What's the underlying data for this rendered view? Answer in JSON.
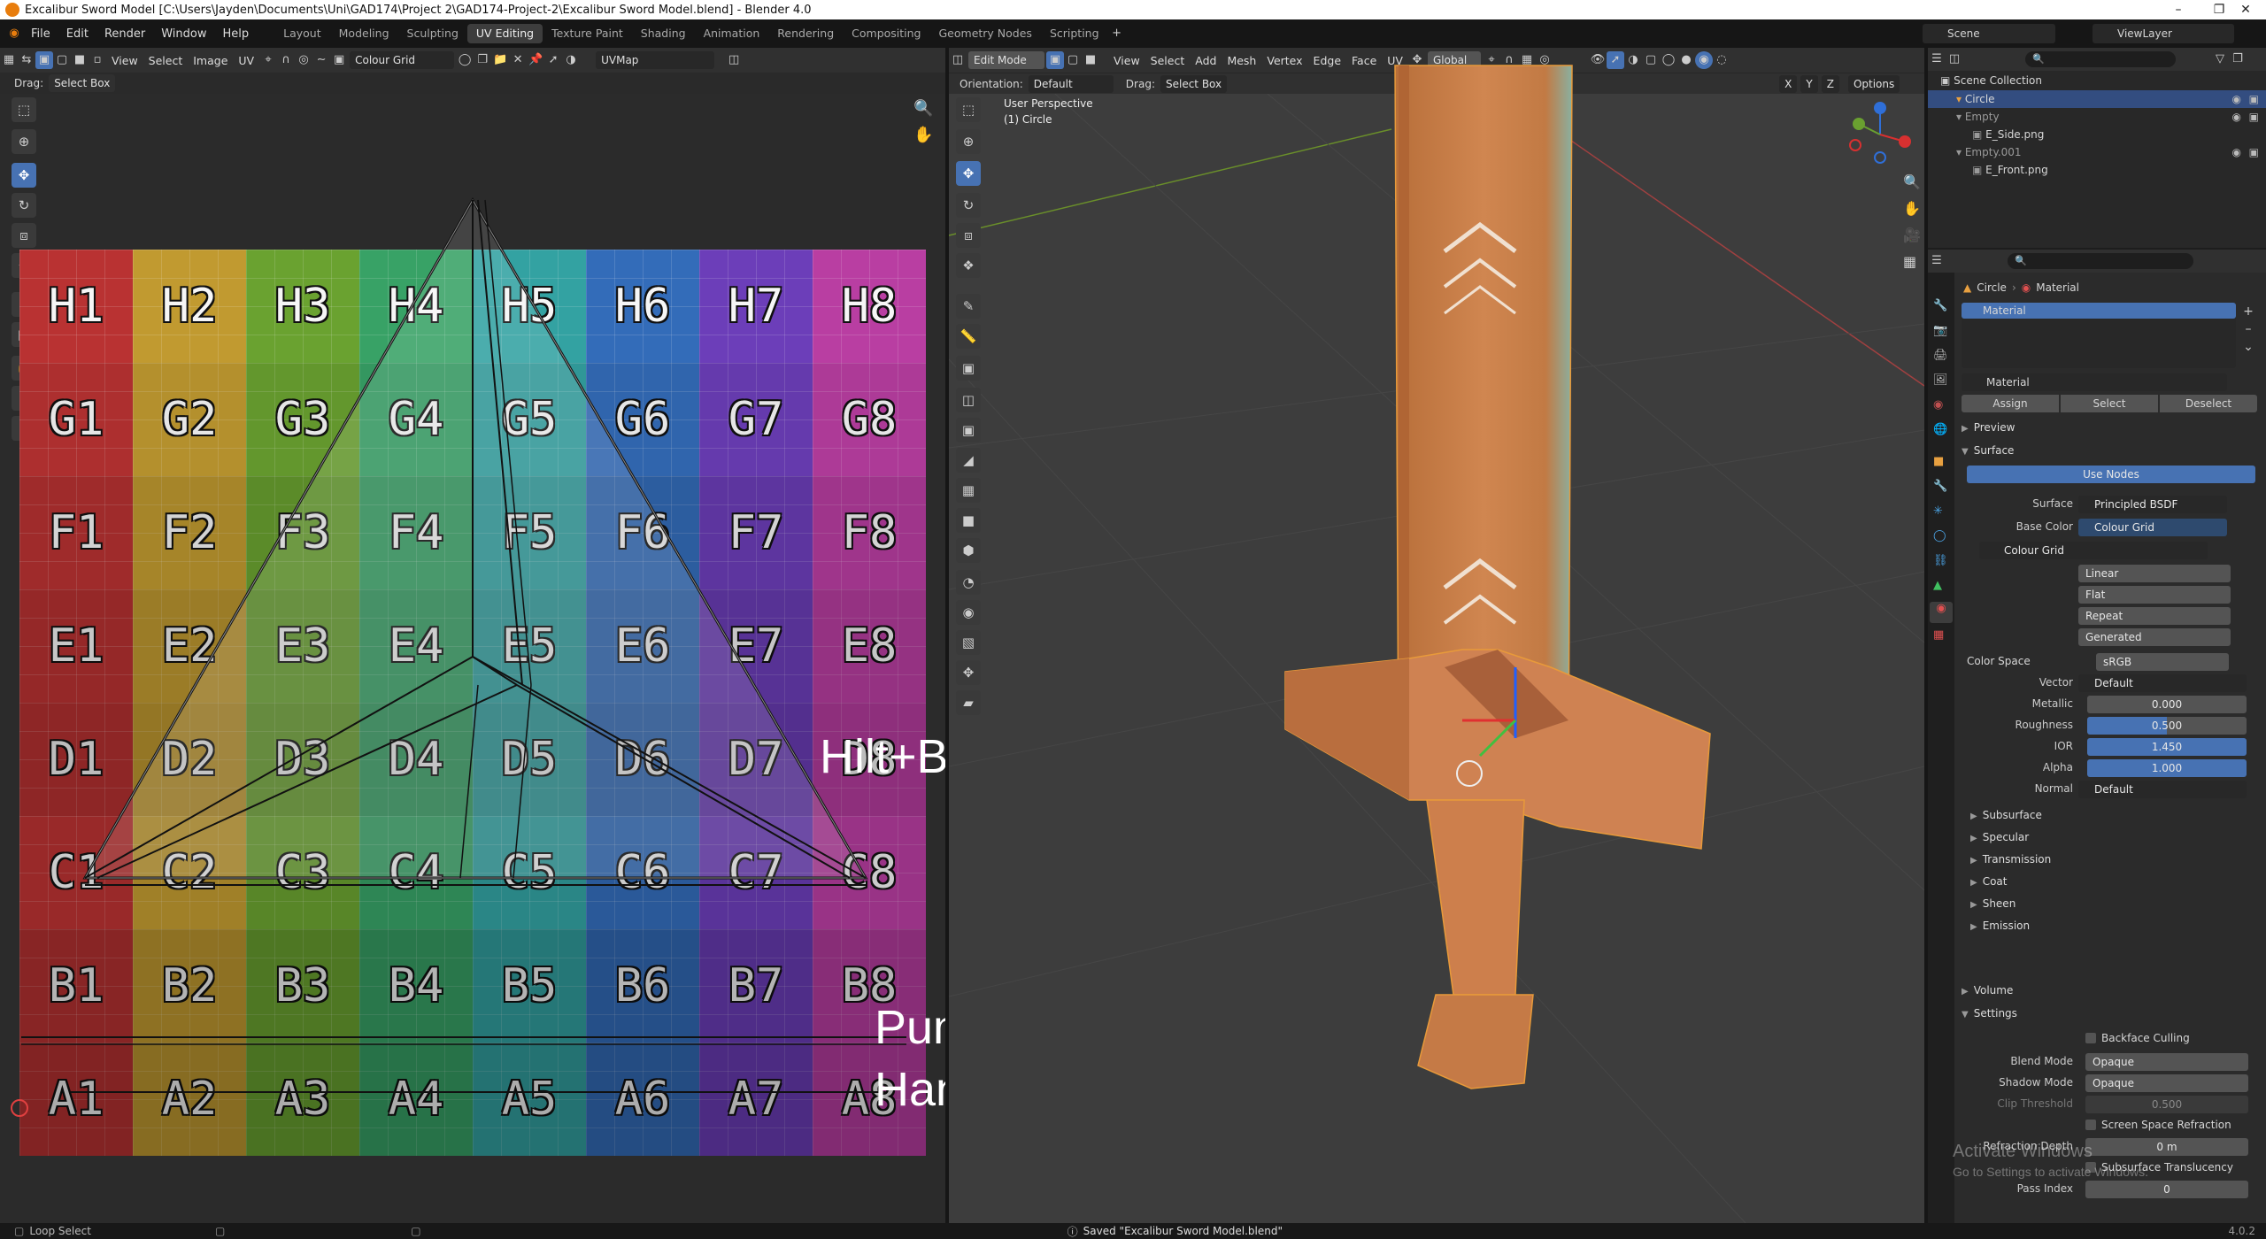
{
  "titlebar": {
    "title": "Excalibur Sword Model [C:\\Users\\Jayden\\Documents\\Uni\\GAD174\\Project 2\\GAD174-Project-2\\Excalibur Sword Model.blend] - Blender 4.0"
  },
  "topbar": {
    "menus": [
      "File",
      "Edit",
      "Render",
      "Window",
      "Help"
    ],
    "workspaces": [
      "Layout",
      "Modeling",
      "Sculpting",
      "UV Editing",
      "Texture Paint",
      "Shading",
      "Animation",
      "Rendering",
      "Compositing",
      "Geometry Nodes",
      "Scripting"
    ],
    "active_workspace": "UV Editing",
    "scene": "Scene",
    "view_layer": "ViewLayer"
  },
  "uv_editor": {
    "menus": [
      "View",
      "Select",
      "Image",
      "UV"
    ],
    "image_name": "Colour Grid",
    "uvmap": "UVMap",
    "drag_label": "Drag:",
    "drag_value": "Select Box",
    "rows": [
      "H",
      "G",
      "F",
      "E",
      "D",
      "C",
      "B",
      "A"
    ],
    "cols": [
      "1",
      "2",
      "3",
      "4",
      "5",
      "6",
      "7",
      "8"
    ],
    "row_colors": [
      "#c03434",
      "#c8a032",
      "#6ea832",
      "#3aa86a",
      "#35a8a8",
      "#3570c0",
      "#7040c0",
      "#c040a8"
    ],
    "annotations": {
      "hilt_blade": "Hilt+Blade",
      "pummel": "Pummle",
      "handle": "Handle"
    }
  },
  "viewport": {
    "mode": "Edit Mode",
    "menus": [
      "View",
      "Select",
      "Add",
      "Mesh",
      "Vertex",
      "Edge",
      "Face",
      "UV"
    ],
    "transform": "Global",
    "orientation_label": "Orientation:",
    "orientation": "Default",
    "drag_label": "Drag:",
    "drag_value": "Select Box",
    "options": "Options",
    "overlay_line1": "User Perspective",
    "overlay_line2": "(1) Circle",
    "axes": {
      "x": "X",
      "y": "Y",
      "z": "Z"
    }
  },
  "outliner": {
    "title": "Scene Collection",
    "items": [
      {
        "name": "Circle",
        "depth": 1,
        "selected": true
      },
      {
        "name": "Empty",
        "depth": 1,
        "selected": false
      },
      {
        "name": "E_Side.png",
        "depth": 2,
        "selected": false
      },
      {
        "name": "Empty.001",
        "depth": 1,
        "selected": false
      },
      {
        "name": "E_Front.png",
        "depth": 2,
        "selected": false
      }
    ]
  },
  "properties": {
    "breadcrumb_object": "Circle",
    "breadcrumb_material": "Material",
    "slot_material": "Material",
    "material_name": "Material",
    "buttons": {
      "assign": "Assign",
      "select": "Select",
      "deselect": "Deselect"
    },
    "sections": {
      "preview": "Preview",
      "surface": "Surface",
      "volume": "Volume",
      "settings": "Settings"
    },
    "use_nodes": "Use Nodes",
    "surface_label": "Surface",
    "surface_value": "Principled BSDF",
    "base_color_label": "Base Color",
    "base_color_value": "Colour Grid",
    "image_name": "Colour Grid",
    "interp": "Linear",
    "projection": "Flat",
    "extension": "Repeat",
    "source": "Generated",
    "color_space_label": "Color Space",
    "color_space": "sRGB",
    "vector_label": "Vector",
    "vector_value": "Default",
    "metallic_label": "Metallic",
    "metallic": "0.000",
    "roughness_label": "Roughness",
    "roughness": "0.500",
    "ior_label": "IOR",
    "ior": "1.450",
    "alpha_label": "Alpha",
    "alpha": "1.000",
    "normal_label": "Normal",
    "normal_value": "Default",
    "subpanels": [
      "Subsurface",
      "Specular",
      "Transmission",
      "Coat",
      "Sheen",
      "Emission"
    ],
    "backface_culling": "Backface Culling",
    "blend_mode_label": "Blend Mode",
    "blend_mode": "Opaque",
    "shadow_mode_label": "Shadow Mode",
    "shadow_mode": "Opaque",
    "clip_label": "Clip Threshold",
    "clip_value": "0.500",
    "ssr": "Screen Space Refraction",
    "refraction_label": "Refraction Depth",
    "refraction_value": "0 m",
    "sst": "Subsurface Translucency",
    "pass_label": "Pass Index",
    "pass_value": "0"
  },
  "watermark": {
    "line1": "Activate Windows",
    "line2": "Go to Settings to activate Windows."
  },
  "statusbar": {
    "left": "Loop Select",
    "message": "Saved \"Excalibur Sword Model.blend\"",
    "version": "4.0.2"
  }
}
